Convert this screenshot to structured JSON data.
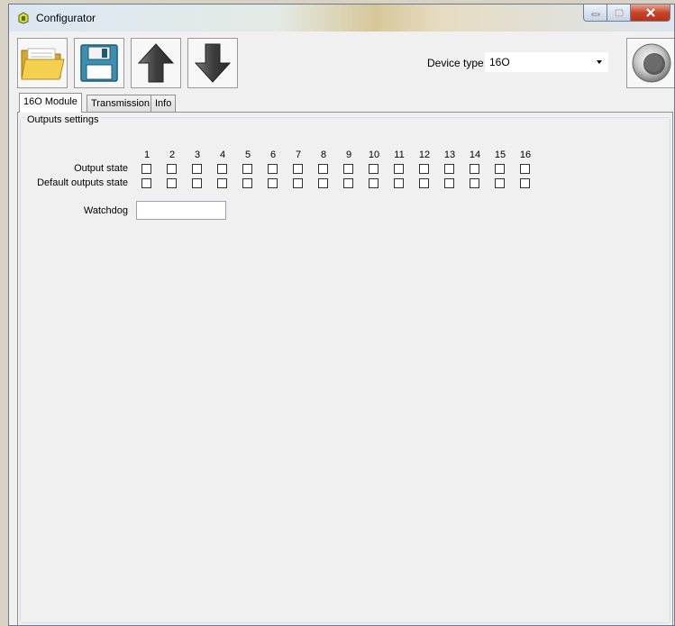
{
  "window": {
    "title": "Configurator"
  },
  "toolbar": {
    "open": "folder-open",
    "save": "floppy-disk",
    "upload": "arrow-up",
    "download": "arrow-down",
    "device_type_label": "Device type:",
    "device_type_value": "16O",
    "connect": "connect-knob"
  },
  "tabs": [
    {
      "label": "16O Module",
      "active": true
    },
    {
      "label": "Transmission",
      "active": false
    },
    {
      "label": "Info",
      "active": false
    }
  ],
  "outputs": {
    "group_title": "Outputs settings",
    "channels": [
      "1",
      "2",
      "3",
      "4",
      "5",
      "6",
      "7",
      "8",
      "9",
      "10",
      "11",
      "12",
      "13",
      "14",
      "15",
      "16"
    ],
    "output_state_label": "Output state",
    "default_state_label": "Default outputs state",
    "output_state": [
      false,
      false,
      false,
      false,
      false,
      false,
      false,
      false,
      false,
      false,
      false,
      false,
      false,
      false,
      false,
      false
    ],
    "default_state": [
      false,
      false,
      false,
      false,
      false,
      false,
      false,
      false,
      false,
      false,
      false,
      false,
      false,
      false,
      false,
      false
    ],
    "watchdog_label": "Watchdog",
    "watchdog_value": ""
  }
}
